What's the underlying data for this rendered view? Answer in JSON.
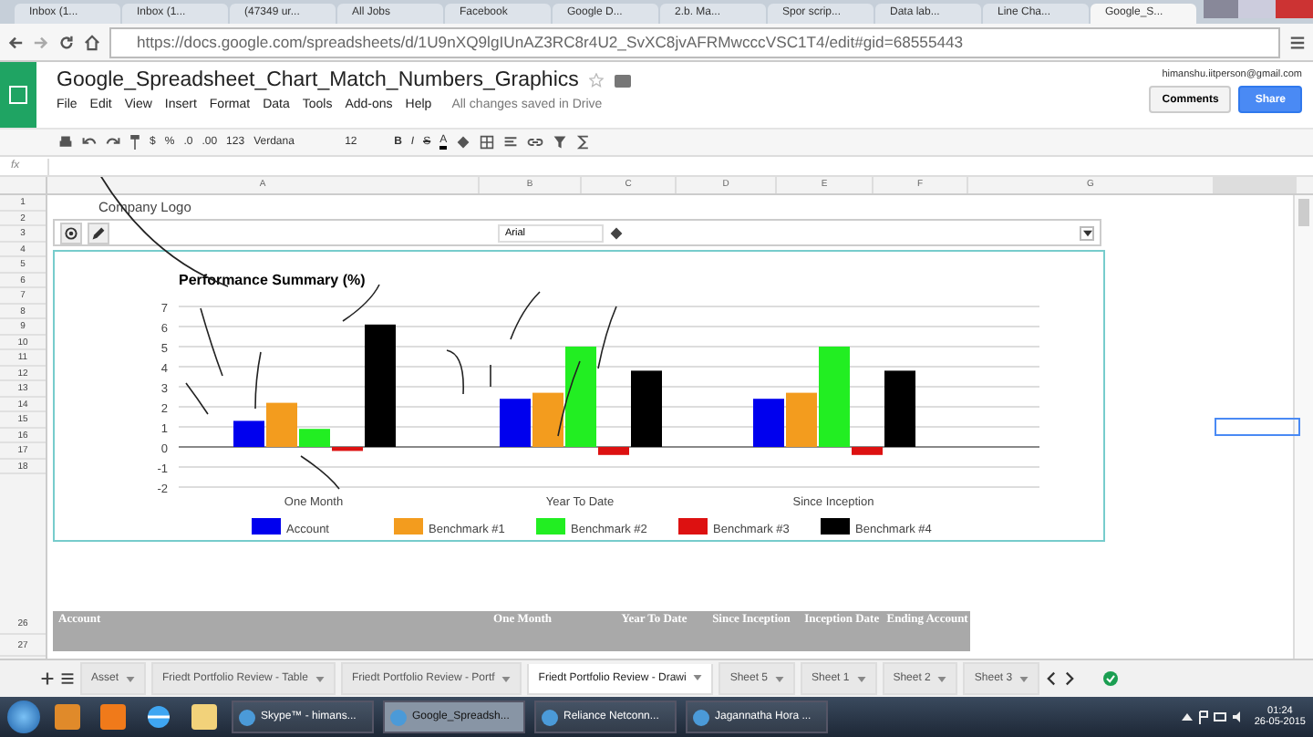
{
  "browser_tabs": [
    {
      "title": "Inbox (1...",
      "selected": false
    },
    {
      "title": "Inbox (1...",
      "selected": false
    },
    {
      "title": "(47349 ur...",
      "selected": false
    },
    {
      "title": "All Jobs",
      "selected": false
    },
    {
      "title": "Facebook",
      "selected": false
    },
    {
      "title": "Google D...",
      "selected": false
    },
    {
      "title": "2.b. Ma...",
      "selected": false
    },
    {
      "title": "Spor scrip...",
      "selected": false
    },
    {
      "title": "Data lab...",
      "selected": false
    },
    {
      "title": "Line Cha...",
      "selected": false
    },
    {
      "title": "Google_S...",
      "selected": true
    }
  ],
  "address": "https://docs.google.com/spreadsheets/d/1U9nXQ9lgIUnAZ3RC8r4U2_SvXC8jvAFRMwcccVSC1T4/edit#gid=68555443",
  "document": {
    "title": "Google_Spreadsheet_Chart_Match_Numbers_Graphics",
    "menu": [
      "File",
      "Edit",
      "View",
      "Insert",
      "Format",
      "Data",
      "Tools",
      "Add-ons",
      "Help"
    ],
    "save_status": "All changes saved in Drive",
    "account": "himanshu.iitperson@gmail.com",
    "buttons": [
      "Comments",
      "Share"
    ]
  },
  "toolbar": {
    "currency": "$",
    "percent": "%",
    "decrease_decimals": ".0",
    "increase_decimals": ".00",
    "number_format": "123",
    "font": "Verdana",
    "font_size": "12",
    "bold": "B",
    "italic": "I",
    "strikethrough": "S",
    "text_color": "A"
  },
  "formula_bar": {
    "label": "fx"
  },
  "columns": [
    "A",
    "B",
    "C",
    "D",
    "E",
    "F",
    "G"
  ],
  "row_numbers": [
    "1",
    "2",
    "3",
    "4",
    "5",
    "6",
    "7",
    "8",
    "9",
    "10",
    "11",
    "12",
    "13",
    "14",
    "15",
    "16",
    "17",
    "18"
  ],
  "lower_row_numbers": [
    "26",
    "27"
  ],
  "cell_a1": "Company Logo",
  "drawing_toolbar": {
    "font": "Arial"
  },
  "chart": {
    "chart_data": {
      "type": "bar",
      "title": "Performance Summary (%)",
      "categories": [
        "One Month",
        "Year To Date",
        "Since Inception"
      ],
      "series": [
        {
          "name": "Account",
          "color": "#0000ee",
          "values": [
            1.3,
            2.4,
            2.4
          ]
        },
        {
          "name": "Benchmark #1",
          "color": "#f39c1e",
          "values": [
            2.2,
            2.7,
            2.7
          ]
        },
        {
          "name": "Benchmark #2",
          "color": "#22ee22",
          "values": [
            0.9,
            5.0,
            5.0
          ]
        },
        {
          "name": "Benchmark #3",
          "color": "#dd1111",
          "values": [
            -0.2,
            -0.4,
            -0.4
          ]
        },
        {
          "name": "Benchmark #4",
          "color": "#000000",
          "values": [
            6.1,
            3.8,
            3.8
          ]
        }
      ],
      "ylim": [
        -2,
        7
      ],
      "yticks": [
        {
          "value": -2,
          "label": "-2"
        },
        {
          "value": -1,
          "label": "-1"
        },
        {
          "value": 0,
          "label": "0"
        },
        {
          "value": 1,
          "label": "1"
        },
        {
          "value": 2,
          "label": "2"
        },
        {
          "value": 3,
          "label": "3"
        },
        {
          "value": 4,
          "label": "4"
        },
        {
          "value": 5,
          "label": "5"
        },
        {
          "value": 6,
          "label": "6"
        },
        {
          "value": 7,
          "label": "7"
        }
      ],
      "grid": true,
      "legend": true
    }
  },
  "table_header": [
    "Account",
    "One Month",
    "Year To Date",
    "Since Inception",
    "Inception Date",
    "Ending Account"
  ],
  "sheet_tabs": [
    {
      "name": "Asset",
      "selected": false
    },
    {
      "name": "Friedt Portfolio Review - Table",
      "selected": false
    },
    {
      "name": "Friedt Portfolio Review - Portf",
      "selected": false
    },
    {
      "name": "Friedt Portfolio Review - Drawi",
      "selected": true
    },
    {
      "name": "Sheet 5",
      "selected": false
    },
    {
      "name": "Sheet 1",
      "selected": false
    },
    {
      "name": "Sheet 2",
      "selected": false
    },
    {
      "name": "Sheet 3",
      "selected": false
    }
  ],
  "taskbar": {
    "windows": [
      {
        "title": "Skype™ - himans...",
        "selected": false
      },
      {
        "title": "Google_Spreadsh...",
        "selected": true
      },
      {
        "title": "Reliance Netconn...",
        "selected": false
      },
      {
        "title": "Jagannatha Hora ...",
        "selected": false
      }
    ],
    "time": "01:24",
    "date": "26-05-2015"
  }
}
